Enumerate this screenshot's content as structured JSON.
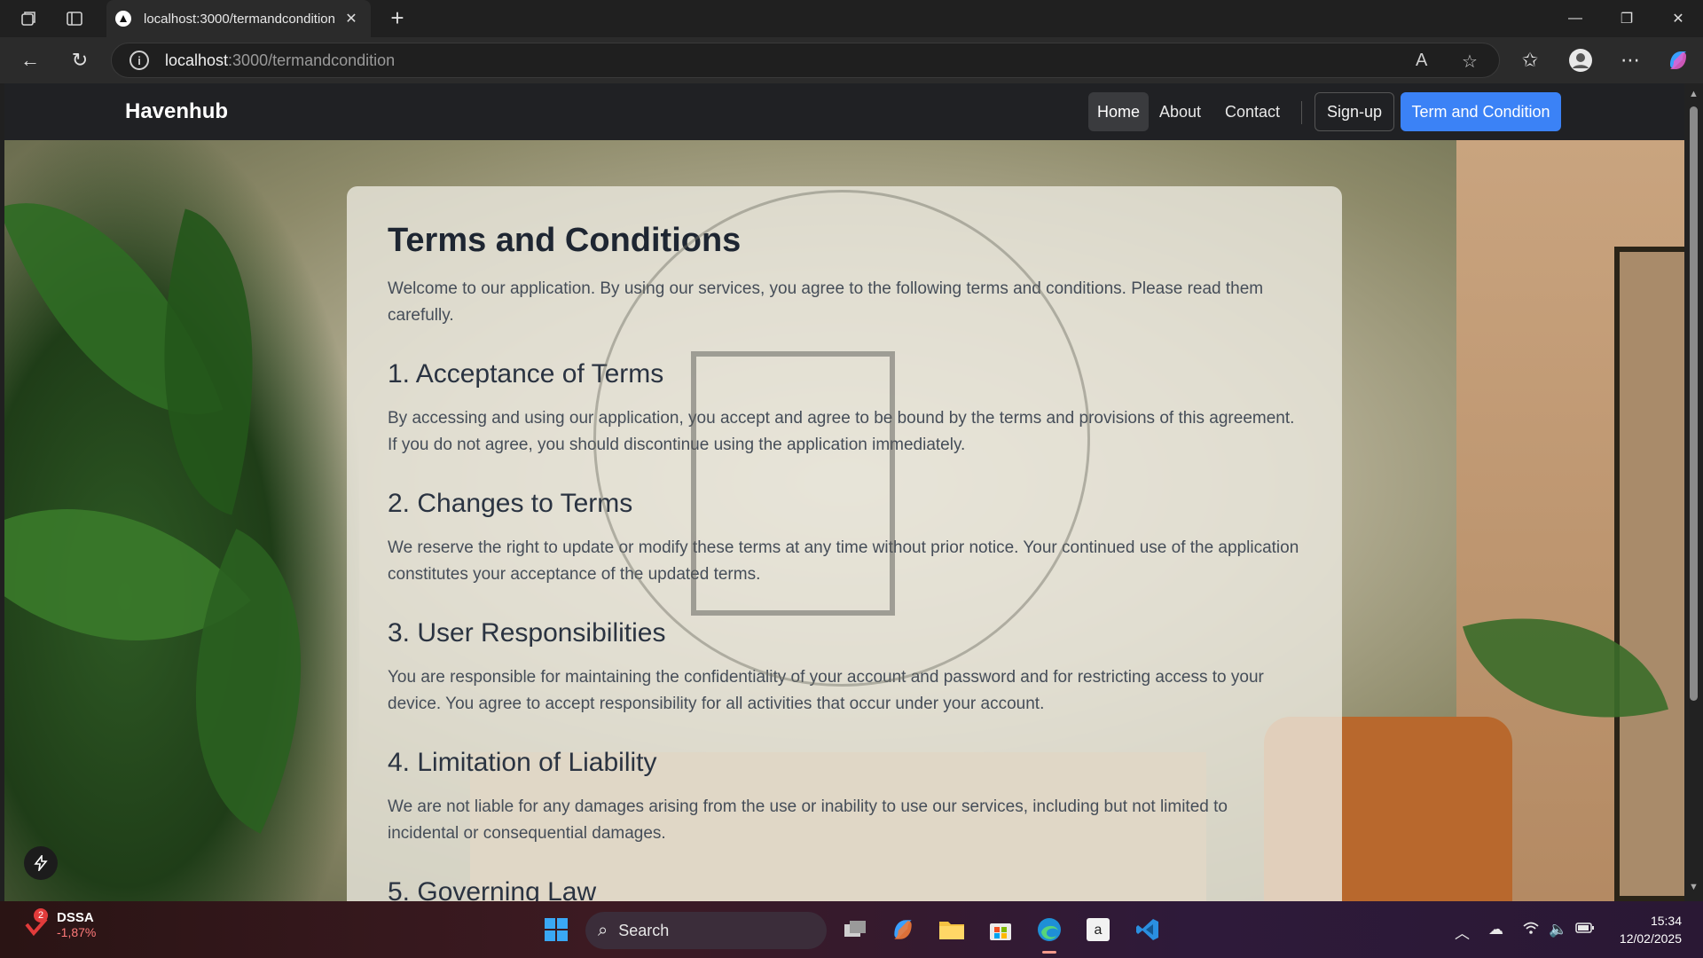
{
  "browser": {
    "tab_title": "localhost:3000/termandcondition",
    "url_host": "localhost",
    "url_path": ":3000/termandcondition"
  },
  "site": {
    "brand": "Havenhub",
    "nav": {
      "home": "Home",
      "about": "About",
      "contact": "Contact",
      "signup": "Sign-up",
      "terms": "Term and Condition"
    }
  },
  "content": {
    "title": "Terms and Conditions",
    "intro": "Welcome to our application. By using our services, you agree to the following terms and conditions. Please read them carefully.",
    "sections": [
      {
        "heading": "1. Acceptance of Terms",
        "body": "By accessing and using our application, you accept and agree to be bound by the terms and provisions of this agreement. If you do not agree, you should discontinue using the application immediately."
      },
      {
        "heading": "2. Changes to Terms",
        "body": "We reserve the right to update or modify these terms at any time without prior notice. Your continued use of the application constitutes your acceptance of the updated terms."
      },
      {
        "heading": "3. User Responsibilities",
        "body": "You are responsible for maintaining the confidentiality of your account and password and for restricting access to your device. You agree to accept responsibility for all activities that occur under your account."
      },
      {
        "heading": "4. Limitation of Liability",
        "body": "We are not liable for any damages arising from the use or inability to use our services, including but not limited to incidental or consequential damages."
      },
      {
        "heading": "5. Governing Law",
        "body": ""
      }
    ]
  },
  "taskbar": {
    "stock_ticker": "DSSA",
    "stock_change": "-1,87%",
    "stock_badge": "2",
    "search_label": "Search",
    "time": "15:34",
    "date": "12/02/2025"
  },
  "colors": {
    "accent": "#3b82f6",
    "navbar_bg": "#202124"
  }
}
